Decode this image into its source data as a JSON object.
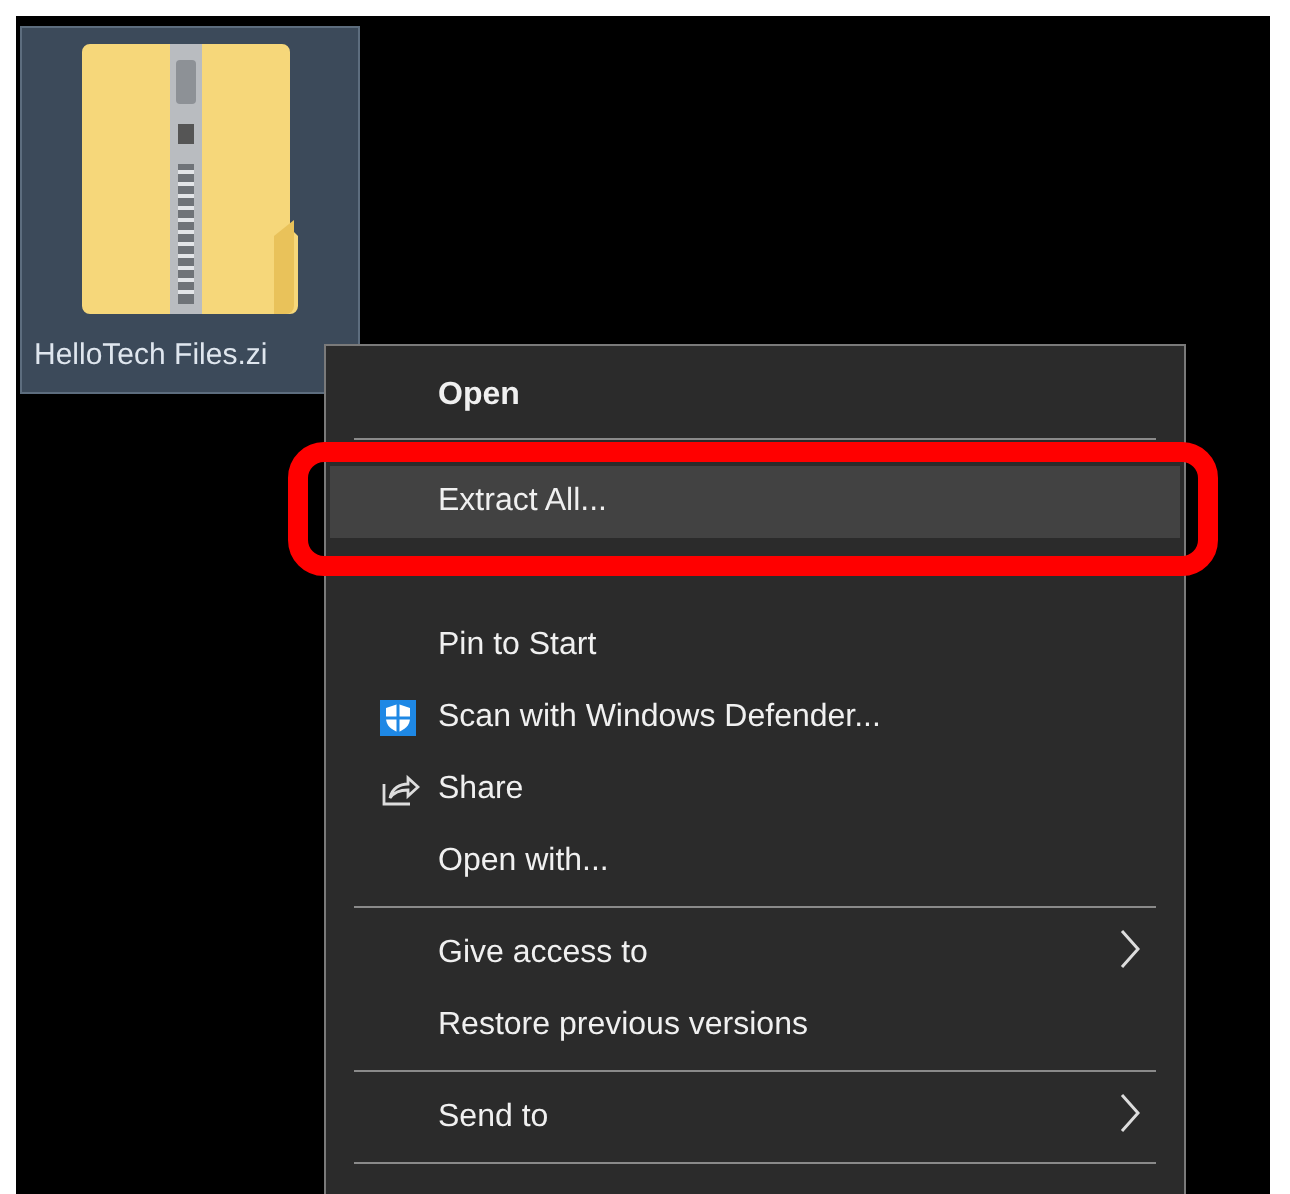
{
  "desktop_icon": {
    "label": "HelloTech Files.zi",
    "selected": true
  },
  "context_menu": {
    "items": [
      {
        "kind": "plain",
        "label": "Open",
        "bold": true,
        "selected": false
      },
      {
        "kind": "separator"
      },
      {
        "kind": "plain",
        "label": "Extract All...",
        "selected": true,
        "annotated": true
      },
      {
        "kind": "covered"
      },
      {
        "kind": "plain",
        "label": "Pin to Start",
        "selected": false
      },
      {
        "kind": "shield",
        "label": "Scan with Windows Defender...",
        "selected": false
      },
      {
        "kind": "share",
        "label": "Share",
        "selected": false
      },
      {
        "kind": "plain",
        "label": "Open with...",
        "selected": false
      },
      {
        "kind": "separator"
      },
      {
        "kind": "plain",
        "label": "Give access to",
        "submenu": true,
        "selected": false
      },
      {
        "kind": "plain",
        "label": "Restore previous versions",
        "selected": false
      },
      {
        "kind": "separator"
      },
      {
        "kind": "plain",
        "label": "Send to",
        "submenu": true,
        "selected": false
      },
      {
        "kind": "separator"
      }
    ]
  }
}
